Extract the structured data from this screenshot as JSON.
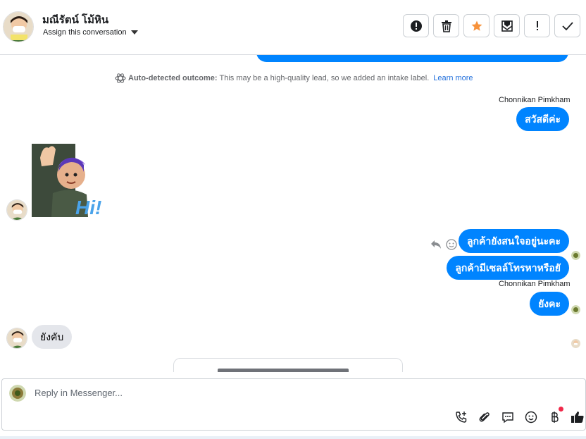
{
  "header": {
    "contact_name": "มณีรัตน์ โม้หิน",
    "assign_label": "Assign this conversation",
    "actions": [
      {
        "name": "spam-button",
        "icon": "alert-circle-icon"
      },
      {
        "name": "delete-button",
        "icon": "trash-icon"
      },
      {
        "name": "star-button",
        "icon": "star-icon",
        "color": "#f7923b"
      },
      {
        "name": "mark-unread-button",
        "icon": "envelope-icon"
      },
      {
        "name": "follow-up-button",
        "icon": "exclamation-icon"
      },
      {
        "name": "mark-done-button",
        "icon": "check-icon"
      }
    ]
  },
  "thread": {
    "auto_detect": {
      "label": "Auto-detected outcome:",
      "text": "This may be a high-quality lead, so we added an intake label.",
      "link": "Learn more"
    },
    "sender_name_1": "Chonnikan Pimkham",
    "sender_name_2": "Chonnikan Pimkham",
    "messages_out": [
      "สวัสดีค่ะ",
      "ลูกค้ายังสนใจอยู่นะคะ",
      "ลูกค้ามีเซลล์โทรหาหรือยั",
      "ยังคะ"
    ],
    "sticker_text": "Hi!",
    "message_in": "ยังคับ"
  },
  "composer": {
    "placeholder": "Reply in Messenger...",
    "tools": [
      "call-add-icon",
      "attachment-icon",
      "saved-reply-icon",
      "emoji-icon",
      "baht-payment-icon",
      "thumbs-up-icon"
    ]
  },
  "colors": {
    "accent": "#0084ff",
    "star": "#f7923b",
    "link": "#216fdb"
  }
}
